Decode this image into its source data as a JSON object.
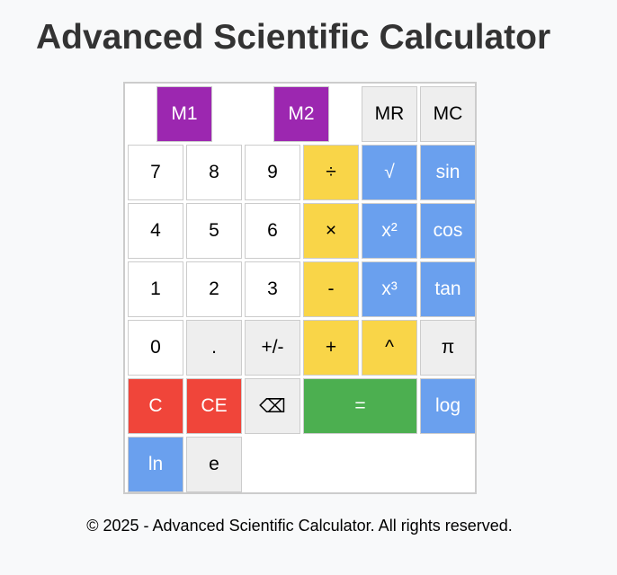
{
  "header": {
    "title": "Advanced Scientific Calculator"
  },
  "calculator": {
    "memory": {
      "m1": "M1",
      "m2": "M2",
      "mr": "MR",
      "mc": "MC"
    },
    "row1": [
      "7",
      "8",
      "9",
      "÷",
      "√",
      "sin"
    ],
    "row2": [
      "4",
      "5",
      "6",
      "×",
      "x²",
      "cos"
    ],
    "row3": [
      "1",
      "2",
      "3",
      "-",
      "x³",
      "tan"
    ],
    "row4": [
      "0",
      ".",
      "+/-",
      "+",
      "^",
      "π"
    ],
    "row5": [
      "C",
      "CE",
      "⌫",
      "=",
      "log"
    ],
    "row6": [
      "ln",
      "e"
    ]
  },
  "footer": {
    "text": "© 2025 - Advanced Scientific Calculator. All rights reserved."
  },
  "colors": {
    "background": "#f8f9fa",
    "title": "#333333",
    "number_button": "#ffffff",
    "gray_button": "#eeeeee",
    "operator_button": "#f9d548",
    "function_button": "#6aa0ee",
    "clear_button": "#f0453a",
    "equals_button": "#4caf50",
    "memory_button": "#9c27b0"
  }
}
